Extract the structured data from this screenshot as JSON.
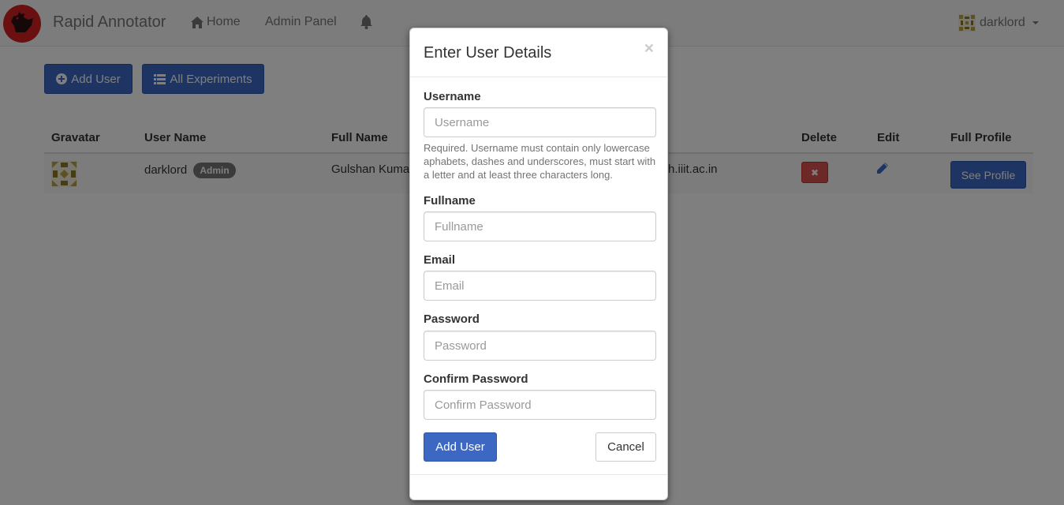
{
  "navbar": {
    "brand": "Rapid Annotator",
    "home_label": "Home",
    "admin_label": "Admin Panel",
    "user_label": "darklord",
    "icons": {
      "logo": "rooster-logo",
      "home": "home-icon",
      "bell": "bell-icon",
      "user_avatar": "identicon-avatar",
      "caret": "caret-down-icon"
    }
  },
  "actions": {
    "add_user_label": "Add User",
    "all_experiments_label": "All Experiments"
  },
  "table": {
    "headers": {
      "gravatar": "Gravatar",
      "username": "User Name",
      "fullname": "Full Name",
      "delete": "Delete",
      "edit": "Edit",
      "profile": "Full Profile"
    },
    "rows": [
      {
        "username": "darklord",
        "badge": "Admin",
        "fullname_partial": "Gulshan Kuma",
        "email_partial": "h.iiit.ac.in",
        "delete_glyph": "✖",
        "profile_button": "See Profile"
      }
    ]
  },
  "modal": {
    "title": "Enter User Details",
    "close_glyph": "×",
    "username_label": "Username",
    "username_placeholder": "Username",
    "username_help": "Required. Username must contain only lowercase aphabets, dashes and underscores, must start with a letter and at least three characters long.",
    "fullname_label": "Fullname",
    "fullname_placeholder": "Fullname",
    "email_label": "Email",
    "email_placeholder": "Email",
    "password_label": "Password",
    "password_placeholder": "Password",
    "confirm_label": "Confirm Password",
    "confirm_placeholder": "Confirm Password",
    "submit_label": "Add User",
    "cancel_label": "Cancel"
  },
  "colors": {
    "primary": "#3c68c4",
    "danger": "#d9534f",
    "badge": "#777777",
    "overlay": "rgba(0,0,0,0.5)"
  }
}
